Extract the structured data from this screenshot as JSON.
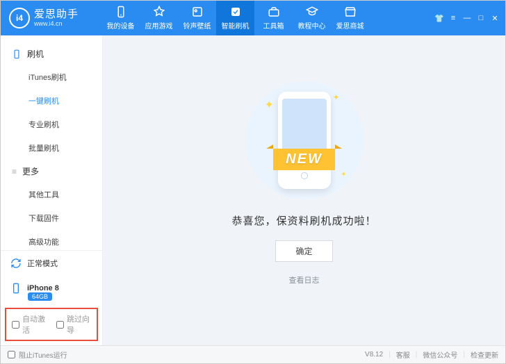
{
  "brand": {
    "title": "爱思助手",
    "sub": "www.i4.cn",
    "logo_text": "i4"
  },
  "topnav": [
    {
      "label": "我的设备"
    },
    {
      "label": "应用游戏"
    },
    {
      "label": "铃声壁纸"
    },
    {
      "label": "智能刷机"
    },
    {
      "label": "工具箱"
    },
    {
      "label": "教程中心"
    },
    {
      "label": "爱思商城"
    }
  ],
  "sidebar": {
    "group1": {
      "title": "刷机"
    },
    "items1": [
      {
        "label": "iTunes刷机"
      },
      {
        "label": "一键刷机"
      },
      {
        "label": "专业刷机"
      },
      {
        "label": "批量刷机"
      }
    ],
    "group2": {
      "title": "更多"
    },
    "items2": [
      {
        "label": "其他工具"
      },
      {
        "label": "下载固件"
      },
      {
        "label": "高级功能"
      }
    ],
    "mode": "正常模式",
    "device": "iPhone 8",
    "storage": "64GB",
    "auto_activate": "自动激活",
    "skip_guide": "跳过向导"
  },
  "main": {
    "banner": "NEW",
    "message": "恭喜您，保资料刷机成功啦！",
    "ok": "确定",
    "log": "查看日志"
  },
  "statusbar": {
    "block_itunes": "阻止iTunes运行",
    "version": "V8.12",
    "service": "客服",
    "wechat": "微信公众号",
    "update": "检查更新"
  }
}
